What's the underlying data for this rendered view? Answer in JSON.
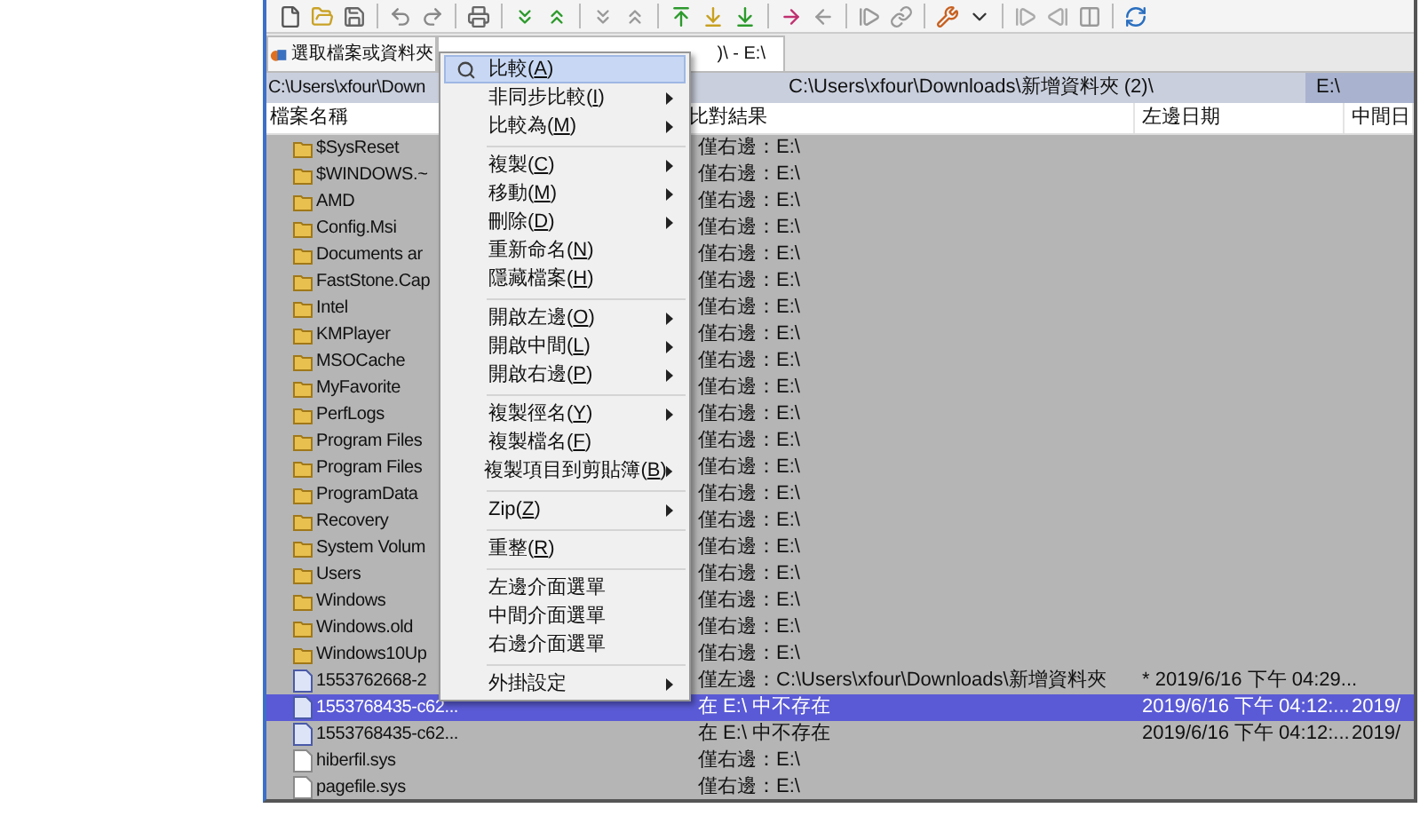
{
  "tabs": [
    {
      "label": "選取檔案或資料夾"
    },
    {
      "label": ")\\ - E:\\"
    }
  ],
  "paths": [
    "C:\\Users\\xfour\\Down",
    "C:\\Users\\xfour\\Downloads\\新增資料夾 (2)\\",
    "E:\\"
  ],
  "columns": [
    "檔案名稱",
    "比對結果",
    "左邊日期",
    "中間日"
  ],
  "rows": [
    {
      "name": "$SysReset",
      "kind": "folder",
      "result": "僅右邊：E:\\",
      "selected": false
    },
    {
      "name": "$WINDOWS.~",
      "kind": "folder",
      "result": "僅右邊：E:\\",
      "selected": false
    },
    {
      "name": "AMD",
      "kind": "folder",
      "result": "僅右邊：E:\\",
      "selected": false
    },
    {
      "name": "Config.Msi",
      "kind": "folder",
      "result": "僅右邊：E:\\",
      "selected": false
    },
    {
      "name": "Documents ar",
      "kind": "folder",
      "result": "僅右邊：E:\\",
      "selected": false
    },
    {
      "name": "FastStone.Cap",
      "kind": "folder",
      "result": "僅右邊：E:\\",
      "selected": false
    },
    {
      "name": "Intel",
      "kind": "folder",
      "result": "僅右邊：E:\\",
      "selected": false
    },
    {
      "name": "KMPlayer",
      "kind": "folder",
      "result": "僅右邊：E:\\",
      "selected": false
    },
    {
      "name": "MSOCache",
      "kind": "folder",
      "result": "僅右邊：E:\\",
      "selected": false
    },
    {
      "name": "MyFavorite",
      "kind": "folder",
      "result": "僅右邊：E:\\",
      "selected": false
    },
    {
      "name": "PerfLogs",
      "kind": "folder",
      "result": "僅右邊：E:\\",
      "selected": false
    },
    {
      "name": "Program Files",
      "kind": "folder",
      "result": "僅右邊：E:\\",
      "selected": false
    },
    {
      "name": "Program Files",
      "kind": "folder",
      "result": "僅右邊：E:\\",
      "selected": false
    },
    {
      "name": "ProgramData",
      "kind": "folder",
      "result": "僅右邊：E:\\",
      "selected": false
    },
    {
      "name": "Recovery",
      "kind": "folder",
      "result": "僅右邊：E:\\",
      "selected": false
    },
    {
      "name": "System Volum",
      "kind": "folder",
      "result": "僅右邊：E:\\",
      "selected": false
    },
    {
      "name": "Users",
      "kind": "folder",
      "result": "僅右邊：E:\\",
      "selected": false
    },
    {
      "name": "Windows",
      "kind": "folder",
      "result": "僅右邊：E:\\",
      "selected": false
    },
    {
      "name": "Windows.old",
      "kind": "folder",
      "result": "僅右邊：E:\\",
      "selected": false
    },
    {
      "name": "Windows10Up",
      "kind": "folder",
      "result": "僅右邊：E:\\",
      "selected": false
    },
    {
      "name": "1553762668-2",
      "kind": "file",
      "result": "僅左邊：C:\\Users\\xfour\\Downloads\\新增資料夾",
      "left_date": "* 2019/6/16 下午 04:29...",
      "selected": false
    },
    {
      "name": "1553768435-c62...",
      "kind": "file",
      "result": "在 E:\\ 中不存在",
      "left_date": "2019/6/16 下午 04:12:...",
      "middle_date": "2019/",
      "selected": true
    },
    {
      "name": "1553768435-c62...",
      "kind": "file",
      "result": "在 E:\\ 中不存在",
      "left_date": "2019/6/16 下午 04:12:...",
      "middle_date": "2019/",
      "selected": false
    },
    {
      "name": "hiberfil.sys",
      "kind": "doc",
      "result": "僅右邊：E:\\",
      "selected": false
    },
    {
      "name": "pagefile.sys",
      "kind": "doc",
      "result": "僅右邊：E:\\",
      "selected": false
    }
  ],
  "context_menu": [
    {
      "kind": "item",
      "label": "比較(A)",
      "mnemonic": true,
      "submenu": false,
      "selected": true
    },
    {
      "kind": "item",
      "label": "非同步比較(I)",
      "mnemonic": true,
      "submenu": true,
      "selected": false
    },
    {
      "kind": "item",
      "label": "比較為(M)",
      "mnemonic": true,
      "submenu": true,
      "selected": false
    },
    {
      "kind": "separator"
    },
    {
      "kind": "item",
      "label": "複製(C)",
      "mnemonic": true,
      "submenu": true,
      "selected": false
    },
    {
      "kind": "item",
      "label": "移動(M)",
      "mnemonic": true,
      "submenu": true,
      "selected": false
    },
    {
      "kind": "item",
      "label": "刪除(D)",
      "mnemonic": true,
      "submenu": true,
      "selected": false
    },
    {
      "kind": "item",
      "label": "重新命名(N)",
      "mnemonic": true,
      "submenu": false,
      "selected": false
    },
    {
      "kind": "item",
      "label": "隱藏檔案(H)",
      "mnemonic": true,
      "submenu": false,
      "selected": false
    },
    {
      "kind": "separator"
    },
    {
      "kind": "item",
      "label": "開啟左邊(O)",
      "mnemonic": true,
      "submenu": true,
      "selected": false
    },
    {
      "kind": "item",
      "label": "開啟中間(L)",
      "mnemonic": true,
      "submenu": true,
      "selected": false
    },
    {
      "kind": "item",
      "label": "開啟右邊(P)",
      "mnemonic": true,
      "submenu": true,
      "selected": false
    },
    {
      "kind": "separator"
    },
    {
      "kind": "item",
      "label": "複製徑名(Y)",
      "mnemonic": true,
      "submenu": true,
      "selected": false
    },
    {
      "kind": "item",
      "label": "複製檔名(F)",
      "mnemonic": true,
      "submenu": false,
      "selected": false
    },
    {
      "kind": "item",
      "label": "複製項目到剪貼簿(B)",
      "mnemonic": true,
      "submenu": true,
      "selected": false
    },
    {
      "kind": "separator"
    },
    {
      "kind": "item",
      "label": "Zip(Z)",
      "mnemonic": true,
      "submenu": true,
      "selected": false
    },
    {
      "kind": "separator"
    },
    {
      "kind": "item",
      "label": "重整(R)",
      "mnemonic": true,
      "submenu": false,
      "selected": false
    },
    {
      "kind": "separator"
    },
    {
      "kind": "item",
      "label": "左邊介面選單",
      "mnemonic": false,
      "submenu": false,
      "selected": false
    },
    {
      "kind": "item",
      "label": "中間介面選單",
      "mnemonic": false,
      "submenu": false,
      "selected": false
    },
    {
      "kind": "item",
      "label": "右邊介面選單",
      "mnemonic": false,
      "submenu": false,
      "selected": false
    },
    {
      "kind": "separator"
    },
    {
      "kind": "item",
      "label": "外掛設定",
      "mnemonic": false,
      "submenu": true,
      "selected": false
    }
  ]
}
